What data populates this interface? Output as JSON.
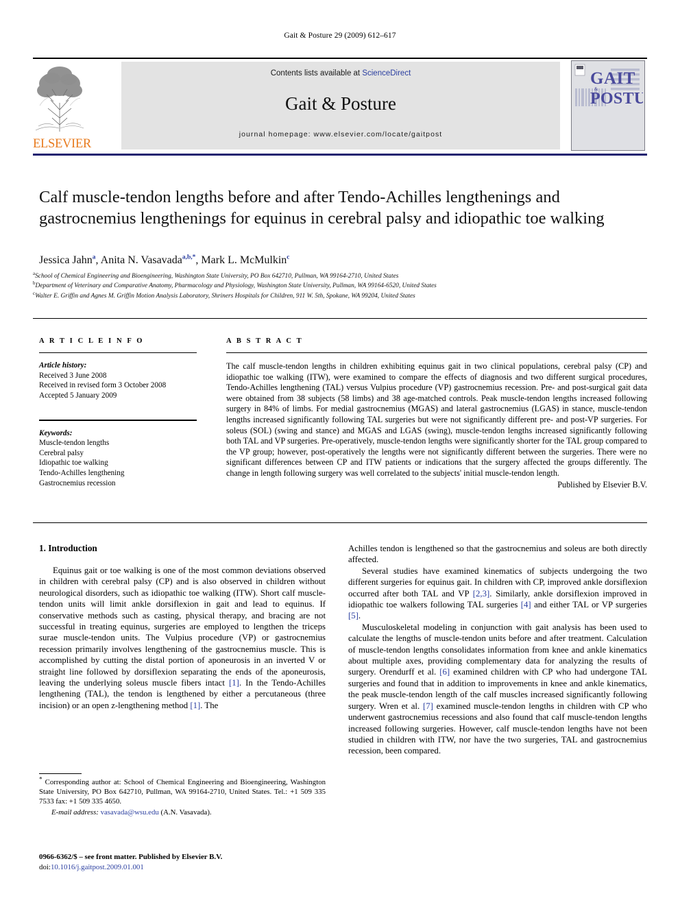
{
  "running_head": "Gait & Posture 29 (2009) 612–617",
  "colors": {
    "link_blue": "#2b3fa0",
    "elsevier_orange": "#E87B1E",
    "masthead_band": "#e3e3e3",
    "rule_navy": "#1b1b6f",
    "cover_bg": "#dfe0e4"
  },
  "masthead": {
    "publisher_logo_label": "ELSEVIER",
    "contents_prefix": "Contents lists available at ",
    "contents_link": "ScienceDirect",
    "journal_title": "Gait & Posture",
    "homepage": "journal homepage: www.elsevier.com/locate/gaitpost",
    "cover": {
      "line1": "GAIT",
      "amp": "&",
      "line2": "POSTURE"
    }
  },
  "article": {
    "title": "Calf muscle-tendon lengths before and after Tendo-Achilles lengthenings and gastrocnemius lengthenings for equinus in cerebral palsy and idiopathic toe walking",
    "authors": [
      {
        "name": "Jessica Jahn",
        "marks": "a"
      },
      {
        "name": "Anita N. Vasavada",
        "marks": "a,b,*"
      },
      {
        "name": "Mark L. McMulkin",
        "marks": "c"
      }
    ],
    "affiliations": [
      {
        "mark": "a",
        "text": "School of Chemical Engineering and Bioengineering, Washington State University, PO Box 642710, Pullman, WA 99164-2710, United States"
      },
      {
        "mark": "b",
        "text": "Department of Veterinary and Comparative Anatomy, Pharmacology and Physiology, Washington State University, Pullman, WA 99164-6520, United States"
      },
      {
        "mark": "c",
        "text": "Walter E. Griffin and Agnes M. Griffin Motion Analysis Laboratory, Shriners Hospitals for Children, 911 W. 5th, Spokane, WA 99204, United States"
      }
    ]
  },
  "article_info": {
    "heading": "A R T I C L E  I N F O",
    "history_label": "Article history:",
    "history": [
      "Received 3 June 2008",
      "Received in revised form 3 October 2008",
      "Accepted 5 January 2009"
    ],
    "keywords_label": "Keywords:",
    "keywords": [
      "Muscle-tendon lengths",
      "Cerebral palsy",
      "Idiopathic toe walking",
      "Tendo-Achilles lengthening",
      "Gastrocnemius recession"
    ]
  },
  "abstract": {
    "heading": "A B S T R A C T",
    "text": "The calf muscle-tendon lengths in children exhibiting equinus gait in two clinical populations, cerebral palsy (CP) and idiopathic toe walking (ITW), were examined to compare the effects of diagnosis and two different surgical procedures, Tendo-Achilles lengthening (TAL) versus Vulpius procedure (VP) gastrocnemius recession. Pre- and post-surgical gait data were obtained from 38 subjects (58 limbs) and 38 age-matched controls. Peak muscle-tendon lengths increased following surgery in 84% of limbs. For medial gastrocnemius (MGAS) and lateral gastrocnemius (LGAS) in stance, muscle-tendon lengths increased significantly following TAL surgeries but were not significantly different pre- and post-VP surgeries. For soleus (SOL) (swing and stance) and MGAS and LGAS (swing), muscle-tendon lengths increased significantly following both TAL and VP surgeries. Pre-operatively, muscle-tendon lengths were significantly shorter for the TAL group compared to the VP group; however, post-operatively the lengths were not significantly different between the surgeries. There were no significant differences between CP and ITW patients or indications that the surgery affected the groups differently. The change in length following surgery was well correlated to the subjects' initial muscle-tendon length.",
    "signature": "Published by Elsevier B.V."
  },
  "body": {
    "section1_heading": "1. Introduction",
    "left_par1_a": "Equinus gait or toe walking is one of the most common deviations observed in children with cerebral palsy (CP) and is also observed in children without neurological disorders, such as idiopathic toe walking (ITW). Short calf muscle-tendon units will limit ankle dorsiflexion in gait and lead to equinus. If conservative methods such as casting, physical therapy, and bracing are not successful in treating equinus, surgeries are employed to lengthen the triceps surae muscle-tendon units. The Vulpius procedure (VP) or gastrocnemius recession primarily involves lengthening of the gastrocnemius muscle. This is accomplished by cutting the distal portion of aponeurosis in an inverted V or straight line followed by dorsiflexion separating the ends of the aponeurosis, leaving the underlying soleus muscle fibers intact ",
    "left_cite1": "[1]",
    "left_par1_b": ". In the Tendo-Achilles lengthening (TAL), the tendon is lengthened by either a percutaneous (three incision) or an open z-lengthening method ",
    "left_cite2": "[1]",
    "left_par1_c": ". The",
    "right_par1": "Achilles tendon is lengthened so that the gastrocnemius and soleus are both directly affected.",
    "right_par2_a": "Several studies have examined kinematics of subjects undergoing the two different surgeries for equinus gait. In children with CP, improved ankle dorsiflexion occurred after both TAL and VP ",
    "right_cite1": "[2,3]",
    "right_par2_b": ". Similarly, ankle dorsiflexion improved in idiopathic toe walkers following TAL surgeries ",
    "right_cite2": "[4]",
    "right_par2_c": " and either TAL or VP surgeries ",
    "right_cite3": "[5]",
    "right_par2_d": ".",
    "right_par3_a": "Musculoskeletal modeling in conjunction with gait analysis has been used to calculate the lengths of muscle-tendon units before and after treatment. Calculation of muscle-tendon lengths consolidates information from knee and ankle kinematics about multiple axes, providing complementary data for analyzing the results of surgery. Orendurff et al. ",
    "right_cite4": "[6]",
    "right_par3_b": " examined children with CP who had undergone TAL surgeries and found that in addition to improvements in knee and ankle kinematics, the peak muscle-tendon length of the calf muscles increased significantly following surgery. Wren et al. ",
    "right_cite5": "[7]",
    "right_par3_c": " examined muscle-tendon lengths in children with CP who underwent gastrocnemius recessions and also found that calf muscle-tendon lengths increased following surgeries. However, calf muscle-tendon lengths have not been studied in children with ITW, nor have the two surgeries, TAL and gastrocnemius recession, been compared."
  },
  "footnote": {
    "star": "*",
    "corresponding": " Corresponding author at: School of Chemical Engineering and Bioengineering, Washington State University, PO Box 642710, Pullman, WA 99164-2710, United States. Tel.: +1 509 335 7533 fax: +1 509 335 4650.",
    "email_label": "E-mail address:",
    "email": "vasavada@wsu.edu",
    "email_suffix": " (A.N. Vasavada)."
  },
  "imprint": {
    "front_matter": "0966-6362/$ – see front matter. Published by Elsevier B.V.",
    "doi_label": "doi:",
    "doi_value": "10.1016/j.gaitpost.2009.01.001"
  }
}
